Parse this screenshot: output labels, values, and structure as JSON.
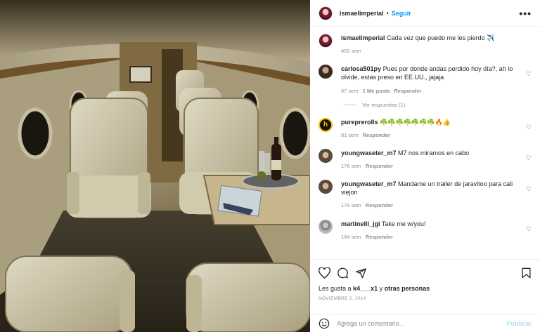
{
  "post": {
    "username": "ismaelimperial",
    "follow_label": "Seguir",
    "more_label": "•••",
    "caption": "Cada vez que puedo me les pierdo ✈️",
    "caption_time": "402 sem"
  },
  "comments": [
    {
      "user": "carlosa501py",
      "text": "Pues por donde andas perdido hoy día?, ah lo olvide, estas preso en EE.UU., jajaja",
      "time": "67 sem",
      "likes": "1 Me gusta",
      "reply": "Responder",
      "view_replies": "Ver respuestas (1)"
    },
    {
      "user": "purepreroIIs",
      "text": "☘️☘️☘️☘️☘️☘️☘️🔥👍",
      "time": "81 sem",
      "reply": "Responder"
    },
    {
      "user": "youngwaseter_m7",
      "text": "M7 nos miramos en cabo",
      "time": "176 sem",
      "reply": "Responder"
    },
    {
      "user": "youngwaseter_m7",
      "text": "Mandame un trailer de jaravitoo para cali viejon",
      "time": "176 sem",
      "reply": "Responder"
    },
    {
      "user": "martinelli_jgi",
      "text": "Take me w/you!",
      "time": "184 sem",
      "reply": "Responder"
    }
  ],
  "likes": {
    "prefix": "Les gusta a",
    "user": "k4___x1",
    "suffix": "y",
    "others": "otras personas"
  },
  "date": "NOVIEMBRE 2, 2014",
  "add_comment": {
    "placeholder": "Agrega un comentario...",
    "publish": "Publicar"
  },
  "icons": [
    "heart-icon",
    "comment-icon",
    "share-icon",
    "bookmark-icon",
    "emoji-icon"
  ],
  "colors": {
    "link": "#0095f6",
    "muted": "#8e8e8e",
    "publish_disabled": "#b2dffc"
  }
}
